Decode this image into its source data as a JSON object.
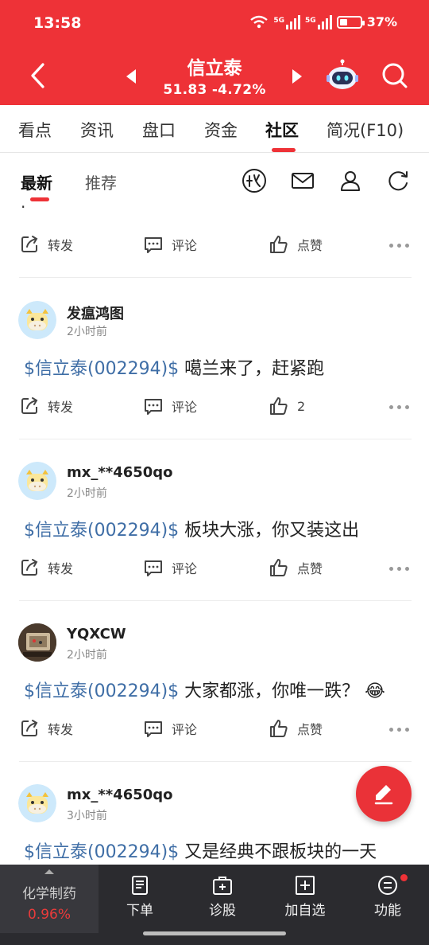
{
  "status_bar": {
    "time": "13:58",
    "signal1_label": "5G",
    "signal2_label": "5G",
    "battery": "37%",
    "battery_level": 0.37
  },
  "header": {
    "stock_name": "信立泰",
    "price_change": "51.83 -4.72%"
  },
  "tabs": [
    {
      "label": "看点"
    },
    {
      "label": "资讯"
    },
    {
      "label": "盘口"
    },
    {
      "label": "资金"
    },
    {
      "label": "社区"
    },
    {
      "label": "简况(F10)"
    }
  ],
  "subtabs": [
    {
      "label": "最新"
    },
    {
      "label": "推荐"
    }
  ],
  "subtab_icons": [
    "stock-bar-icon",
    "mail-icon",
    "user-icon",
    "refresh-icon"
  ],
  "actions": {
    "repost": "转发",
    "comment": "评论",
    "like": "点赞"
  },
  "truncated_line": "·",
  "posts": [
    {
      "user": "发瘟鸿图",
      "time": "2小时前",
      "stock_tag": "$信立泰(002294)$",
      "text": " 噶兰来了，赶紧跑",
      "likes": "2",
      "emoji": ""
    },
    {
      "user": "mx_**4650qo",
      "time": "2小时前",
      "stock_tag": "$信立泰(002294)$",
      "text": " 板块大涨，你又装这出",
      "likes": "点赞",
      "emoji": ""
    },
    {
      "user": "YQXCW",
      "time": "2小时前",
      "stock_tag": "$信立泰(002294)$",
      "text": " 大家都涨，你唯一跌？",
      "likes": "点赞",
      "emoji": "😂"
    },
    {
      "user": "mx_**4650qo",
      "time": "3小时前",
      "stock_tag": "$信立泰(002294)$",
      "text": " 又是经典不跟板块的一天",
      "likes": "",
      "emoji": ""
    }
  ],
  "bottom_bar": {
    "stock_name": "化学制药",
    "stock_pct": "0.96%",
    "items": [
      {
        "label": "下单"
      },
      {
        "label": "诊股"
      },
      {
        "label": "加自选"
      },
      {
        "label": "功能"
      }
    ]
  },
  "colors": {
    "brand_red": "#ee3237",
    "link_blue": "#3f6ea6",
    "bottom_bg": "#2b2b2f"
  }
}
